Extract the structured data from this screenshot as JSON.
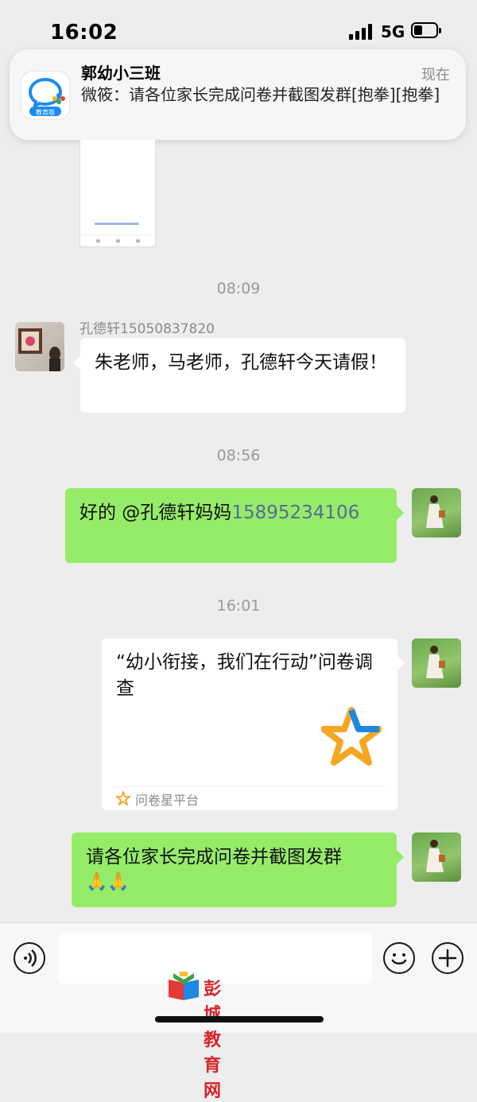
{
  "status_bar": {
    "time": "16:02",
    "network": "5G"
  },
  "notification": {
    "title": "郭幼小三班",
    "time": "现在",
    "body": "微筱：请各位家长完成问卷并截图发群[抱拳][抱拳]",
    "app_badge": "教育版"
  },
  "chat": {
    "timestamps": [
      "08:09",
      "08:56",
      "16:01"
    ],
    "msg1": {
      "sender": "孔德轩15050837820",
      "text": "朱老师，马老师，孔德轩今天请假！"
    },
    "msg2": {
      "prefix": "好的 @孔德轩妈妈",
      "phone": "15895234106"
    },
    "msg3": {
      "title": "“幼小衔接，我们在行动”问卷调查",
      "source": "问卷星平台"
    },
    "msg4": {
      "text": "请各位家长完成问卷并截图发群",
      "emoji": "🙏🙏"
    }
  },
  "input_bar": {
    "input_value": ""
  },
  "watermark": {
    "text": "彭城教育网"
  },
  "colors": {
    "bubble_green": "#95ec69",
    "link": "#576b95",
    "background": "#ededed"
  }
}
